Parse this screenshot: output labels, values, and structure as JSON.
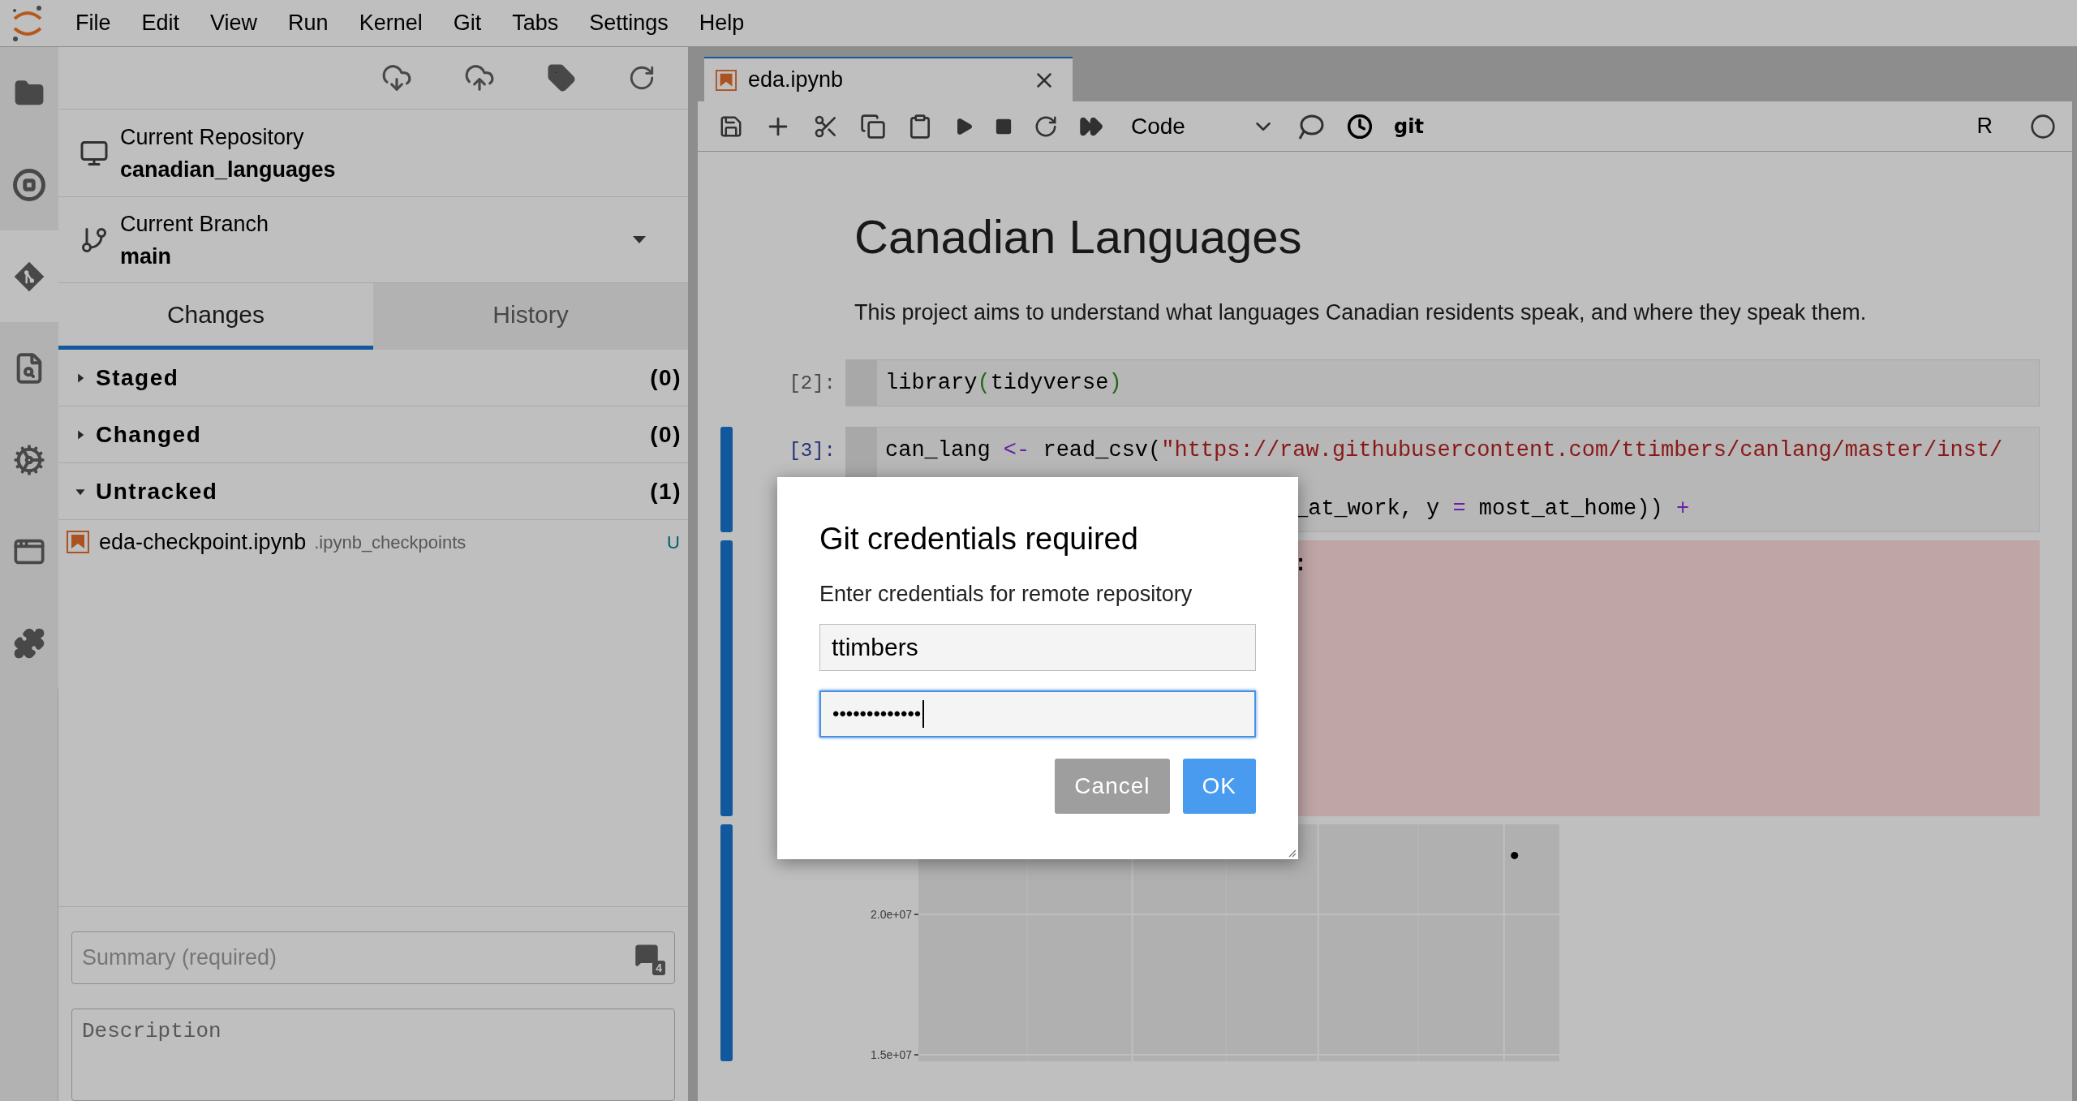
{
  "menu_bar": {
    "items": [
      "File",
      "Edit",
      "View",
      "Run",
      "Kernel",
      "Git",
      "Tabs",
      "Settings",
      "Help"
    ]
  },
  "activity_bar": [
    {
      "selected": false
    },
    {
      "selected": false
    },
    {
      "selected": true
    },
    {
      "selected": false
    },
    {
      "selected": false
    },
    {
      "selected": false
    },
    {
      "selected": false
    }
  ],
  "git_panel": {
    "repository": {
      "label": "Current Repository",
      "value": "canadian_languages"
    },
    "branch": {
      "label": "Current Branch",
      "value": "main"
    },
    "tabs": [
      {
        "label": "Changes",
        "selected": true
      },
      {
        "label": "History",
        "selected": false
      }
    ],
    "sections": [
      {
        "title": "Staged",
        "count": "(0)",
        "expanded": false
      },
      {
        "title": "Changed",
        "count": "(0)",
        "expanded": false
      },
      {
        "title": "Untracked",
        "count": "(1)",
        "expanded": true,
        "files": [
          {
            "name": "eda-checkpoint.ipynb",
            "path": ".ipynb_checkpoints",
            "status": "U"
          }
        ]
      }
    ],
    "commit": {
      "summary_placeholder": "Summary (required)",
      "badge": "4",
      "description_placeholder": "Description"
    }
  },
  "notebook": {
    "tabs": [
      {
        "label": "eda.ipynb",
        "selected": true
      }
    ],
    "toolbar": {
      "cell_type": "Code",
      "git_label": "git",
      "kernel": "R"
    },
    "cells": [
      {
        "kind": "markdown",
        "heading": "Canadian Languages",
        "paragraph": "This project aims to understand what languages Canadian residents speak, and where they speak them."
      },
      {
        "kind": "code",
        "prompt": "[2]:",
        "selected": false,
        "lines": [
          {
            "tokens": [
              {
                "kind": "plain",
                "text": "library"
              },
              {
                "kind": "bracket",
                "text": "("
              },
              {
                "kind": "plain",
                "text": "tidyverse"
              },
              {
                "kind": "bracket",
                "text": ")"
              }
            ]
          }
        ]
      },
      {
        "kind": "code",
        "prompt": "[3]:",
        "selected": true,
        "lines": [
          {
            "tokens": [
              {
                "kind": "plain",
                "text": "can_lang"
              },
              {
                "kind": "operator",
                "text": " <- "
              },
              {
                "kind": "plain",
                "text": "read_csv("
              },
              {
                "kind": "string",
                "text": "\"https://raw.githubusercontent.com/ttimbers/canlang/master/inst/"
              }
            ]
          },
          {
            "covered": true,
            "tokens": [
              {
                "kind": "plain",
                "text": "_at_work, y "
              },
              {
                "kind": "operator",
                "text": "="
              },
              {
                "kind": "plain",
                "text": " most_at_home)) "
              },
              {
                "kind": "operator",
                "text": "+"
              }
            ]
          }
        ],
        "outputs": [
          {
            "kind": "error",
            "covered": true,
            "text": ":"
          },
          {
            "kind": "plot",
            "chart_data": {
              "type": "scatter",
              "ylim": [
                14770000,
                23210000
              ],
              "yticks": [
                {
                  "value": 15000000,
                  "label": "1.5e+07"
                },
                {
                  "value": 20000000,
                  "label": "2.0e+07"
                }
              ],
              "values": [
                22100000
              ]
            }
          }
        ]
      }
    ]
  },
  "dialog": {
    "title": "Git credentials required",
    "message": "Enter credentials for remote repository",
    "username": "ttimbers",
    "password": "•••••••••••••",
    "password_focused": true,
    "buttons": [
      {
        "label": "Cancel",
        "kind": "secondary"
      },
      {
        "label": "OK",
        "kind": "primary"
      }
    ]
  }
}
